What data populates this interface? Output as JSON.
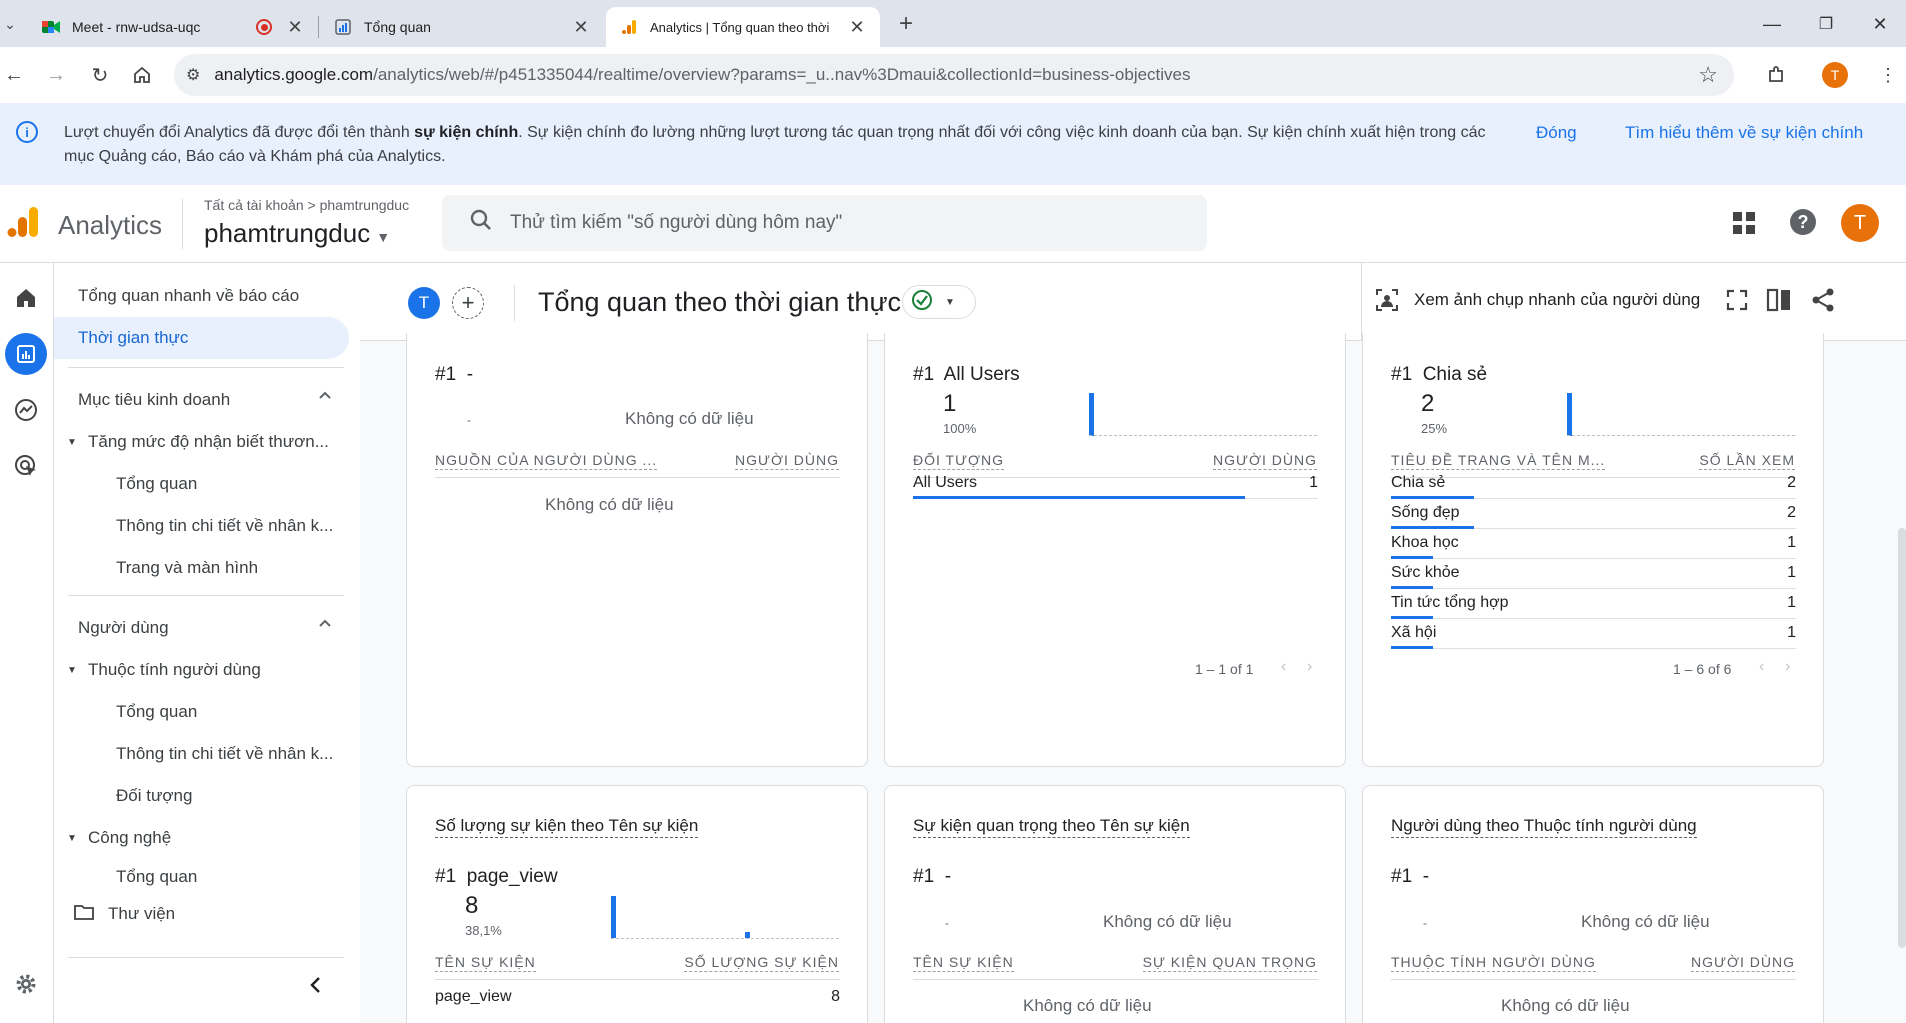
{
  "browser": {
    "tabs": [
      {
        "title": "Meet - rnw-udsa-uqc"
      },
      {
        "title": "Tổng quan"
      },
      {
        "title": "Analytics | Tổng quan theo thời"
      }
    ],
    "new_tab": "+",
    "url_host": "analytics.google.com",
    "url_path": "/analytics/web/#/p451335044/realtime/overview?params=_u..nav%3Dmaui&collectionId=business-objectives",
    "profile_initial": "T"
  },
  "banner": {
    "text_before": "Lượt chuyển đổi Analytics đã được đổi tên thành ",
    "text_bold": "sự kiện chính",
    "text_after": ". Sự kiện chính đo lường những lượt tương tác quan trọng nhất đối với công việc kinh doanh của bạn. Sự kiện chính xuất hiện trong các mục Quảng cáo, Báo cáo và Khám phá của Analytics.",
    "close_label": "Đóng",
    "learn_more_label": "Tìm hiểu thêm về sự kiện chính"
  },
  "ga_header": {
    "product": "Analytics",
    "breadcrumb_all": "Tất cả tài khoản",
    "breadcrumb_account": "phamtrungduc",
    "property": "phamtrungduc",
    "search_placeholder": "Thử tìm kiếm \"số người dùng hôm nay\"",
    "avatar_initial": "T"
  },
  "sidenav": {
    "items": [
      {
        "label": "Tổng quan nhanh về báo cáo"
      },
      {
        "label": "Thời gian thực"
      },
      {
        "label": "Mục tiêu kinh doanh"
      },
      {
        "label": "Tăng mức độ nhận biết thươn..."
      },
      {
        "label": "Tổng quan"
      },
      {
        "label": "Thông tin chi tiết về nhân k..."
      },
      {
        "label": "Trang và màn hình"
      },
      {
        "label": "Người dùng"
      },
      {
        "label": "Thuộc tính người dùng"
      },
      {
        "label": "Tổng quan"
      },
      {
        "label": "Thông tin chi tiết về nhân k..."
      },
      {
        "label": "Đối tượng"
      },
      {
        "label": "Công nghệ"
      },
      {
        "label": "Tổng quan"
      },
      {
        "label": "Thư viện"
      }
    ]
  },
  "realtime": {
    "avatar_initial": "T",
    "title": "Tổng quan theo thời gian thực",
    "snapshot_label": "Xem ảnh chụp nhanh của người dùng"
  },
  "cards": {
    "c1": {
      "rank": "#1",
      "rank_name": "-",
      "no_data": "Không có dữ liệu",
      "dash": "-",
      "col1": "NGUỒN CỦA NGƯỜI DÙNG ...",
      "col2": "NGƯỜI DÙNG",
      "table_no_data": "Không có dữ liệu"
    },
    "c2": {
      "rank": "#1",
      "rank_name": "All Users",
      "big_value": "1",
      "pct": "100%",
      "col1": "ĐỐI TƯỢNG",
      "col2": "NGƯỜI DÙNG",
      "rows": [
        {
          "label": "All Users",
          "value": "1",
          "share": 1.0
        }
      ],
      "pager": "1 – 1 of 1"
    },
    "c3": {
      "rank": "#1",
      "rank_name": "Chia sẻ",
      "big_value": "2",
      "pct": "25%",
      "col1": "TIÊU ĐỀ TRANG VÀ TÊN M...",
      "col2": "SỐ LẦN XEM",
      "rows": [
        {
          "label": "Chia sẻ",
          "value": "2",
          "share": 0.25
        },
        {
          "label": "Sống đẹp",
          "value": "2",
          "share": 0.25
        },
        {
          "label": "Khoa học",
          "value": "1",
          "share": 0.125
        },
        {
          "label": "Sức khỏe",
          "value": "1",
          "share": 0.125
        },
        {
          "label": "Tin tức tổng hợp",
          "value": "1",
          "share": 0.125
        },
        {
          "label": "Xã hội",
          "value": "1",
          "share": 0.125
        }
      ],
      "pager": "1 – 6 of 6"
    },
    "c4": {
      "title": "Số lượng sự kiện theo Tên sự kiện",
      "rank": "#1",
      "rank_name": "page_view",
      "big_value": "8",
      "pct": "38,1%",
      "col1": "TÊN SỰ KIỆN",
      "col2": "SỐ LƯỢNG SỰ KIỆN",
      "rows": [
        {
          "label": "page_view",
          "value": "8"
        }
      ]
    },
    "c5": {
      "title": "Sự kiện quan trọng theo Tên sự kiện",
      "rank": "#1",
      "rank_name": "-",
      "no_data": "Không có dữ liệu",
      "dash": "-",
      "col1": "TÊN SỰ KIỆN",
      "col2": "SỰ KIỆN QUAN TRỌNG",
      "table_no_data": "Không có dữ liệu"
    },
    "c6": {
      "title": "Người dùng theo Thuộc tính người dùng",
      "rank": "#1",
      "rank_name": "-",
      "no_data": "Không có dữ liệu",
      "dash": "-",
      "col1": "THUỘC TÍNH NGƯỜI DÙNG",
      "col2": "NGƯỜI DÙNG",
      "table_no_data": "Không có dữ liệu"
    }
  },
  "colors": {
    "accent": "#1a73e8",
    "avatar": "#e8710a",
    "banner_bg": "#e8f0fe"
  }
}
